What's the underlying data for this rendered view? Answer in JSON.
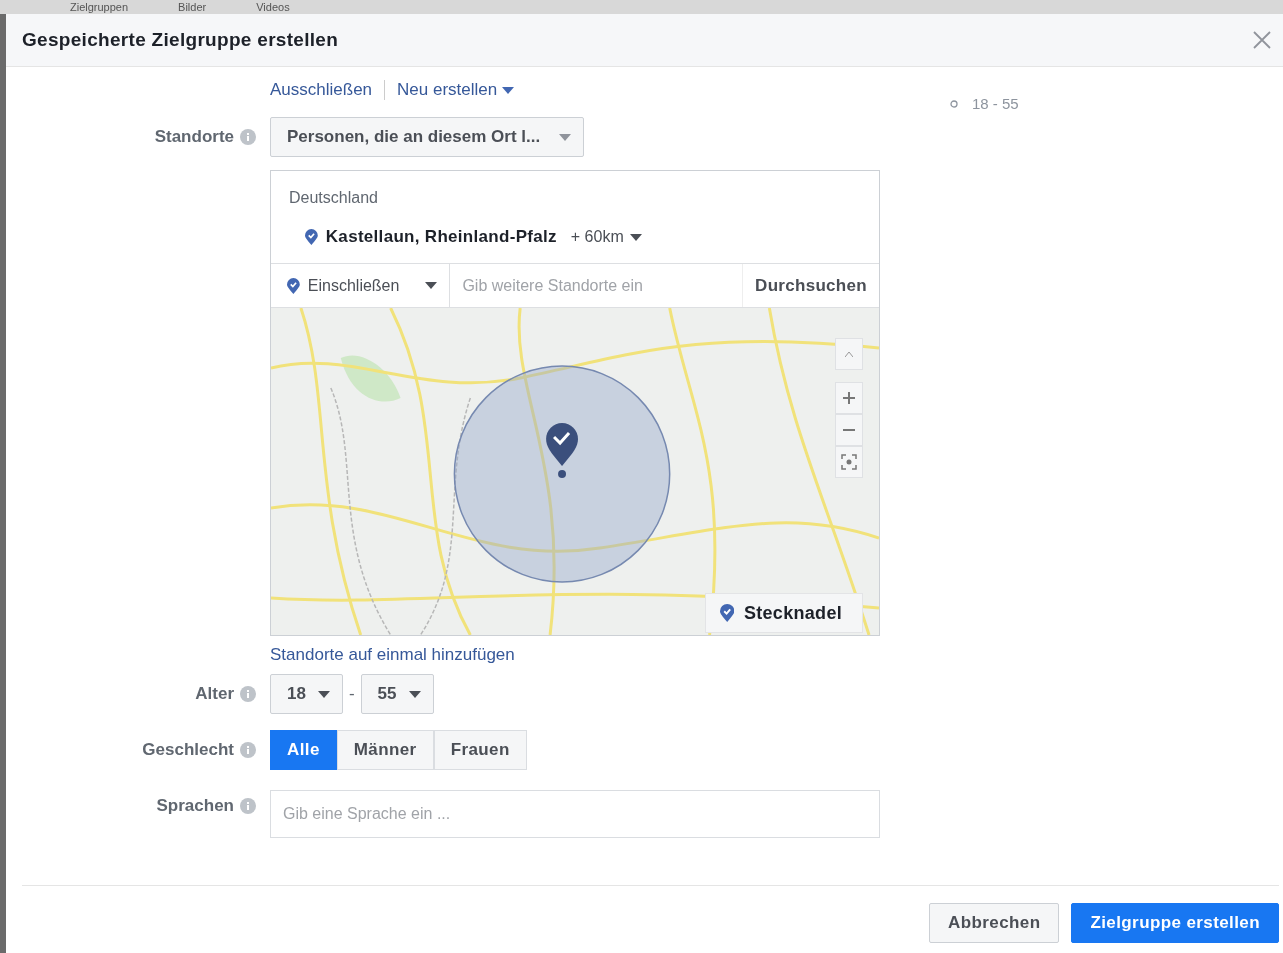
{
  "backdrop_tabs": [
    "Zielgruppen",
    "Bilder",
    "Videos"
  ],
  "dialog": {
    "title": "Gespeicherte Zielgruppe erstellen"
  },
  "links": [
    {
      "label": "Ausschließen",
      "dropdown": false
    },
    {
      "label": "Neu erstellen",
      "dropdown": true
    }
  ],
  "locations": {
    "label": "Standorte",
    "type_select": "Personen, die an diesem Ort l...",
    "country": "Deutschland",
    "selected_location": "Kastellaun, Rheinland-Pfalz",
    "radius": "+ 60km",
    "mode_select": "Einschließen",
    "search_placeholder": "Gib weitere Standorte ein",
    "browse": "Durchsuchen",
    "pin_button": "Stecknadel",
    "bulk_link": "Standorte auf einmal hinzufügen"
  },
  "age": {
    "label": "Alter",
    "min": "18",
    "separator": "-",
    "max": "55"
  },
  "gender": {
    "label": "Geschlecht",
    "options": [
      {
        "label": "Alle",
        "selected": true
      },
      {
        "label": "Männer",
        "selected": false
      },
      {
        "label": "Frauen",
        "selected": false
      }
    ]
  },
  "languages": {
    "label": "Sprachen",
    "placeholder": "Gib eine Sprache ein ..."
  },
  "summary": [
    "18 - 55"
  ],
  "buttons": [
    {
      "label": "Abbrechen",
      "kind": "secondary"
    },
    {
      "label": "Zielgruppe erstellen",
      "kind": "primary"
    }
  ]
}
